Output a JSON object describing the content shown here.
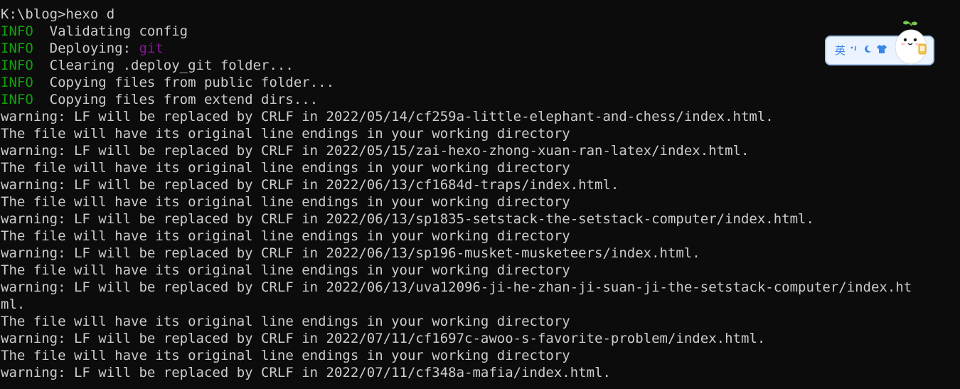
{
  "terminal": {
    "lines": [
      {
        "text": "K:\\blog>hexo d"
      },
      {
        "tag": "INFO",
        "text": "  Validating config"
      },
      {
        "tag": "INFO",
        "text": "  Deploying: ",
        "highlight": "git"
      },
      {
        "tag": "INFO",
        "text": "  Clearing .deploy_git folder..."
      },
      {
        "tag": "INFO",
        "text": "  Copying files from public folder..."
      },
      {
        "tag": "INFO",
        "text": "  Copying files from extend dirs..."
      },
      {
        "text": "warning: LF will be replaced by CRLF in 2022/05/14/cf259a-little-elephant-and-chess/index.html."
      },
      {
        "text": "The file will have its original line endings in your working directory"
      },
      {
        "text": "warning: LF will be replaced by CRLF in 2022/05/15/zai-hexo-zhong-xuan-ran-latex/index.html."
      },
      {
        "text": "The file will have its original line endings in your working directory"
      },
      {
        "text": "warning: LF will be replaced by CRLF in 2022/06/13/cf1684d-traps/index.html."
      },
      {
        "text": "The file will have its original line endings in your working directory"
      },
      {
        "text": "warning: LF will be replaced by CRLF in 2022/06/13/sp1835-setstack-the-setstack-computer/index.html."
      },
      {
        "text": "The file will have its original line endings in your working directory"
      },
      {
        "text": "warning: LF will be replaced by CRLF in 2022/06/13/sp196-musket-musketeers/index.html."
      },
      {
        "text": "The file will have its original line endings in your working directory"
      },
      {
        "text": "warning: LF will be replaced by CRLF in 2022/06/13/uva12096-ji-he-zhan-ji-suan-ji-the-setstack-computer/index.ht"
      },
      {
        "text": "ml."
      },
      {
        "text": "The file will have its original line endings in your working directory"
      },
      {
        "text": "warning: LF will be replaced by CRLF in 2022/07/11/cf1697c-awoo-s-favorite-problem/index.html."
      },
      {
        "text": "The file will have its original line endings in your working directory"
      },
      {
        "text": "warning: LF will be replaced by CRLF in 2022/07/11/cf348a-mafia/index.html."
      }
    ]
  },
  "ime": {
    "lang_label": "英",
    "icons": [
      "punctuation-icon",
      "moon-icon",
      "shirt-icon"
    ],
    "mascot": "mascot-icon"
  },
  "colors": {
    "background": "#0c0c0c",
    "text": "#cccccc",
    "info": "#13a10e",
    "git": "#881798",
    "ime_bg": "#eaf3ff",
    "ime_border": "#a9c8ee",
    "ime_accent": "#3b86e6"
  }
}
